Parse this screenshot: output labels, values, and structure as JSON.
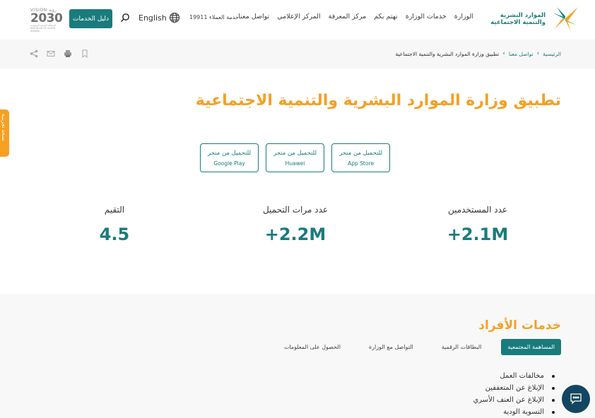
{
  "header": {
    "logo_line1": "الموارد البشرية",
    "logo_line2": "والتنمية الاجتماعية",
    "nav": [
      "الوزارة",
      "خدمات الوزارة",
      "نهتم بكم",
      "مركز المعرفة",
      "المركز الإعلامي",
      "تواصل معنا"
    ],
    "hotline": "خدمة العملاء 19911",
    "language": "English",
    "services_guide": "دليل الخدمات",
    "vision": {
      "top": "VISION رؤية",
      "year": "2030",
      "bottom": "المملكة العربية السعودية KINGDOM OF SAUDI ARABIA"
    }
  },
  "breadcrumb": {
    "items": [
      "الرئيسية",
      "تواصل معنا"
    ],
    "current": "تطبيق وزارة الموارد البشرية والتنمية الاجتماعية",
    "separator": "›",
    "tools": [
      "bookmark",
      "print",
      "email",
      "share"
    ]
  },
  "side_tab": "نسخة تجريبية",
  "page_title": "تطبيق وزارة الموارد البشرية والتنمية الاجتماعية",
  "stores": [
    {
      "label": "للتحميل من متجر",
      "store": "App Store"
    },
    {
      "label": "للتحميل من متجر",
      "store": "Huawei"
    },
    {
      "label": "للتحميل من متجر",
      "store": "Google Play"
    }
  ],
  "stats": {
    "users": {
      "label": "عدد المستخدمين",
      "value": "+2.1M"
    },
    "downloads": {
      "label": "عدد مرات التحميل",
      "value": "+2.2M"
    },
    "rating": {
      "label": "التقيم",
      "value": "4.5"
    }
  },
  "individual_services": {
    "title": "خدمات الأفراد",
    "tabs": [
      "المساهمة المجتمعية",
      "البطاقات الرقمية",
      "التواصل مع الوزارة",
      "الحصول على المعلومات"
    ],
    "active_tab": "المساهمة المجتمعية",
    "items": [
      "مخالفات العمل",
      "الإبلاغ عن المتعففين",
      "الإبلاغ عن العنف الأسري",
      "التسوية الودية"
    ]
  },
  "colors": {
    "primary": "#1a7b7c",
    "accent": "#f5a023",
    "chat": "#134660"
  }
}
